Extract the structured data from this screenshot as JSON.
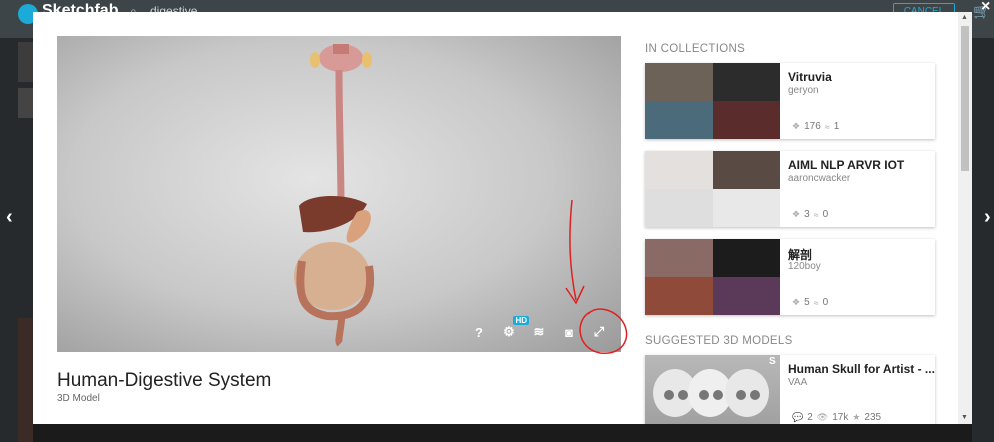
{
  "background": {
    "logo_text": "Sketchfab",
    "search_text": "digestive",
    "right_button": "CANCEL",
    "nav_left": "‹",
    "nav_right": "›",
    "close": "×"
  },
  "model": {
    "title": "Human-Digestive System",
    "subtitle": "3D Model"
  },
  "viewer_controls": {
    "help": "?",
    "hd_badge": "HD"
  },
  "collections": {
    "label": "IN COLLECTIONS",
    "items": [
      {
        "name": "Vitruvia",
        "owner": "geryon",
        "models": "176",
        "followers": "1"
      },
      {
        "name": "AIML NLP ARVR IOT",
        "owner": "aaroncwacker",
        "models": "3",
        "followers": "0"
      },
      {
        "name": "解剖",
        "owner": "120boy",
        "models": "5",
        "followers": "0"
      }
    ]
  },
  "suggested": {
    "label": "SUGGESTED 3D MODELS",
    "item": {
      "name": "Human Skull for Artist - ...",
      "owner": "VAA",
      "comments": "2",
      "views": "17k",
      "likes": "235",
      "staff_badge": "S"
    }
  },
  "colors": {
    "accent": "#1caad9",
    "annotation": "#e02020"
  }
}
